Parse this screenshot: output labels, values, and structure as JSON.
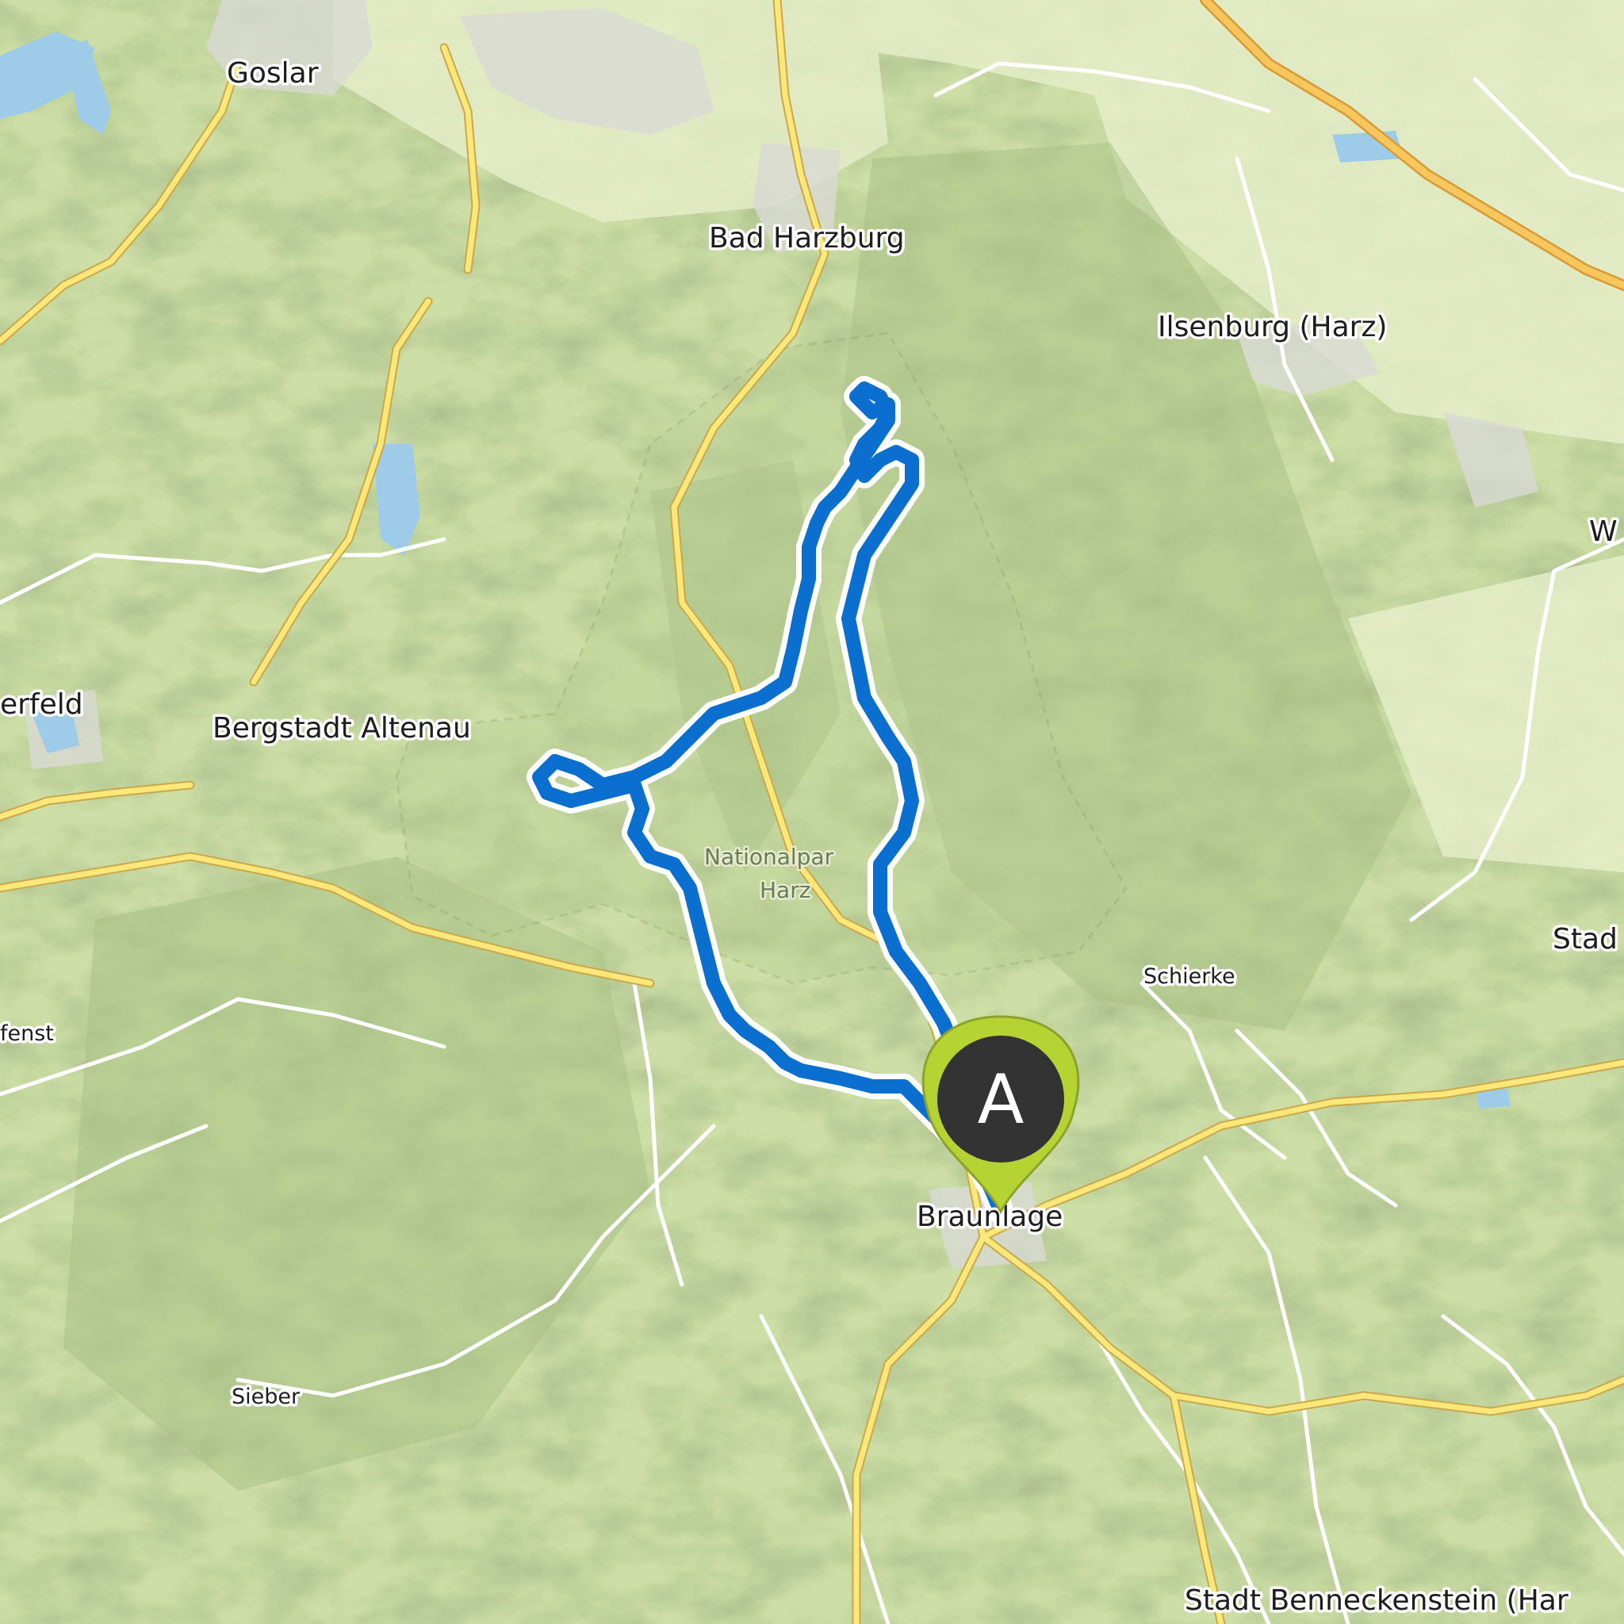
{
  "map": {
    "labels": {
      "goslar": "Goslar",
      "bad_harzburg": "Bad Harzburg",
      "ilsenburg": "Ilsenburg (Harz)",
      "bergstadt_altenau": "Bergstadt Altenau",
      "clausthal_partial": "erfeld",
      "nationalpark_line1": "Nationalpar",
      "nationalpark_line2": "Harz",
      "schierke": "Schierke",
      "braunlage": "Braunlage",
      "sieber": "Sieber",
      "benneckenstein": "Stadt Benneckenstein (Har",
      "stadt_partial": "Stad",
      "w_partial": "W",
      "left_partial": "fenst"
    },
    "route": {
      "color": "#0a6fcf",
      "outline_color": "#ffffff"
    },
    "start_marker": {
      "letter": "A",
      "color": "#333333",
      "ring_color": "#b6d334"
    }
  }
}
